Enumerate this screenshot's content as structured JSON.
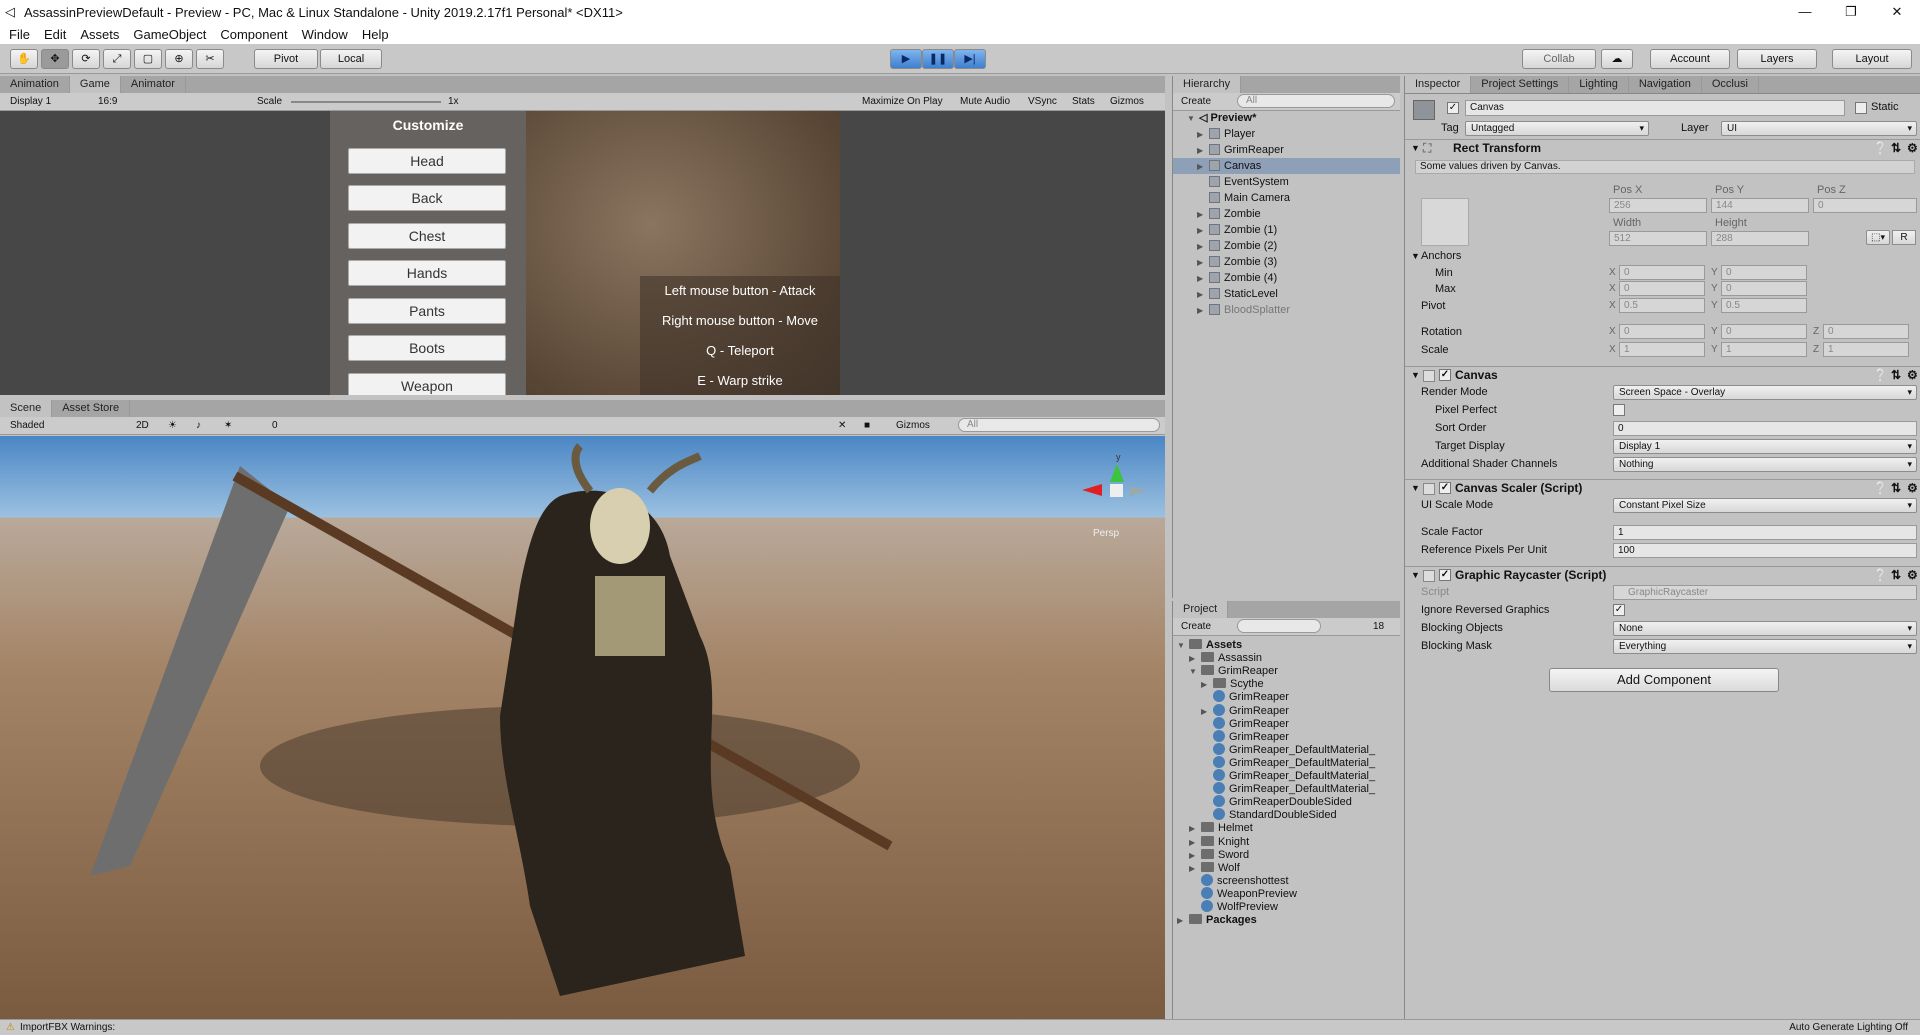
{
  "window": {
    "title": "AssassinPreviewDefault - Preview - PC, Mac & Linux Standalone - Unity 2019.2.17f1 Personal* <DX11>",
    "controls": [
      "—",
      "❐",
      "✕"
    ]
  },
  "menu": [
    "File",
    "Edit",
    "Assets",
    "GameObject",
    "Component",
    "Window",
    "Help"
  ],
  "toolbar": {
    "pivot": "Pivot",
    "local": "Local",
    "collab": "Collab",
    "account": "Account",
    "layers": "Layers",
    "layout": "Layout"
  },
  "game_tabs": [
    "Animation",
    "Game",
    "Animator"
  ],
  "game_bar": {
    "display": "Display 1",
    "aspect": "16:9",
    "scale_label": "Scale",
    "scale_value": "1x",
    "maximize": "Maximize On Play",
    "mute": "Mute Audio",
    "vsync": "VSync",
    "stats": "Stats",
    "gizmos": "Gizmos"
  },
  "customize": {
    "title": "Customize",
    "buttons": [
      "Head",
      "Back",
      "Chest",
      "Hands",
      "Pants",
      "Boots",
      "Weapon"
    ]
  },
  "controls_help": [
    "Left mouse button - Attack",
    "Right mouse button - Move",
    "Q - Teleport",
    "E - Warp strike"
  ],
  "scene_tabs": [
    "Scene",
    "Asset Store"
  ],
  "scene_bar": {
    "shading": "Shaded",
    "mode2d": "2D",
    "fx_count": "0",
    "gizmos": "Gizmos",
    "search": "All"
  },
  "scene_gizmo": {
    "y": "y",
    "persp": "Persp"
  },
  "hierarchy": {
    "tab": "Hierarchy",
    "create": "Create",
    "search": "All",
    "scene": "Preview*",
    "items": [
      {
        "name": "Player",
        "arrow": true,
        "dim": false
      },
      {
        "name": "GrimReaper",
        "arrow": true,
        "dim": false
      },
      {
        "name": "Canvas",
        "arrow": true,
        "dim": false,
        "selected": true
      },
      {
        "name": "EventSystem",
        "arrow": false,
        "dim": false
      },
      {
        "name": "Main Camera",
        "arrow": false,
        "dim": false
      },
      {
        "name": "Zombie",
        "arrow": true,
        "dim": false
      },
      {
        "name": "Zombie (1)",
        "arrow": true,
        "dim": false
      },
      {
        "name": "Zombie (2)",
        "arrow": true,
        "dim": false
      },
      {
        "name": "Zombie (3)",
        "arrow": true,
        "dim": false
      },
      {
        "name": "Zombie (4)",
        "arrow": true,
        "dim": false
      },
      {
        "name": "StaticLevel",
        "arrow": true,
        "dim": false
      },
      {
        "name": "BloodSplatter",
        "arrow": true,
        "dim": true
      }
    ]
  },
  "project": {
    "tab": "Project",
    "create": "Create",
    "count": "18",
    "items": [
      {
        "name": "Assets",
        "level": 0,
        "folder": true,
        "arrow": "open",
        "bold": true
      },
      {
        "name": "Assassin",
        "level": 1,
        "folder": true,
        "arrow": "closed"
      },
      {
        "name": "GrimReaper",
        "level": 1,
        "folder": true,
        "arrow": "open"
      },
      {
        "name": "Scythe",
        "level": 2,
        "folder": true,
        "arrow": "closed"
      },
      {
        "name": "GrimReaper",
        "level": 2,
        "folder": false,
        "arrow": "none"
      },
      {
        "name": "GrimReaper",
        "level": 2,
        "folder": false,
        "arrow": "closed"
      },
      {
        "name": "GrimReaper",
        "level": 2,
        "folder": false,
        "arrow": "none"
      },
      {
        "name": "GrimReaper",
        "level": 2,
        "folder": false,
        "arrow": "none"
      },
      {
        "name": "GrimReaper_DefaultMaterial_",
        "level": 2,
        "folder": false,
        "arrow": "none"
      },
      {
        "name": "GrimReaper_DefaultMaterial_",
        "level": 2,
        "folder": false,
        "arrow": "none"
      },
      {
        "name": "GrimReaper_DefaultMaterial_",
        "level": 2,
        "folder": false,
        "arrow": "none"
      },
      {
        "name": "GrimReaper_DefaultMaterial_",
        "level": 2,
        "folder": false,
        "arrow": "none"
      },
      {
        "name": "GrimReaperDoubleSided",
        "level": 2,
        "folder": false,
        "arrow": "none"
      },
      {
        "name": "StandardDoubleSided",
        "level": 2,
        "folder": false,
        "arrow": "none"
      },
      {
        "name": "Helmet",
        "level": 1,
        "folder": true,
        "arrow": "closed"
      },
      {
        "name": "Knight",
        "level": 1,
        "folder": true,
        "arrow": "closed"
      },
      {
        "name": "Sword",
        "level": 1,
        "folder": true,
        "arrow": "closed"
      },
      {
        "name": "Wolf",
        "level": 1,
        "folder": true,
        "arrow": "closed"
      },
      {
        "name": "screenshottest",
        "level": 1,
        "folder": false,
        "arrow": "none"
      },
      {
        "name": "WeaponPreview",
        "level": 1,
        "folder": false,
        "arrow": "none"
      },
      {
        "name": "WolfPreview",
        "level": 1,
        "folder": false,
        "arrow": "none"
      },
      {
        "name": "Packages",
        "level": 0,
        "folder": true,
        "arrow": "closed",
        "bold": true
      }
    ]
  },
  "inspector_tabs": [
    "Inspector",
    "Project Settings",
    "Lighting",
    "Navigation",
    "Occlusi"
  ],
  "inspector": {
    "object_name": "Canvas",
    "static": "Static",
    "tag_label": "Tag",
    "tag": "Untagged",
    "layer_label": "Layer",
    "layer": "UI",
    "rect": {
      "title": "Rect Transform",
      "note": "Some values driven by Canvas.",
      "posx_l": "Pos X",
      "posy_l": "Pos Y",
      "posz_l": "Pos Z",
      "posx": "256",
      "posy": "144",
      "posz": "0",
      "w_l": "Width",
      "h_l": "Height",
      "w": "512",
      "h": "288",
      "r": "R",
      "anchors": "Anchors",
      "min": "Min",
      "max": "Max",
      "pivot": "Pivot",
      "rotation": "Rotation",
      "scale": "Scale",
      "x": "X",
      "y": "Y",
      "z": "Z",
      "minx": "0",
      "miny": "0",
      "maxx": "0",
      "maxy": "0",
      "pivx": "0.5",
      "pivy": "0.5",
      "rotx": "0",
      "roty": "0",
      "rotz": "0",
      "sclx": "1",
      "scly": "1",
      "sclz": "1"
    },
    "canvas": {
      "title": "Canvas",
      "render_mode_l": "Render Mode",
      "render_mode": "Screen Space - Overlay",
      "pixel_perfect": "Pixel Perfect",
      "sort_order_l": "Sort Order",
      "sort_order": "0",
      "target_display_l": "Target Display",
      "target_display": "Display 1",
      "shader_l": "Additional Shader Channels",
      "shader": "Nothing"
    },
    "scaler": {
      "title": "Canvas Scaler (Script)",
      "mode_l": "UI Scale Mode",
      "mode": "Constant Pixel Size",
      "factor_l": "Scale Factor",
      "factor": "1",
      "ppu_l": "Reference Pixels Per Unit",
      "ppu": "100"
    },
    "raycaster": {
      "title": "Graphic Raycaster (Script)",
      "script_l": "Script",
      "script": "GraphicRaycaster",
      "ignore_l": "Ignore Reversed Graphics",
      "blocking_l": "Blocking Objects",
      "blocking": "None",
      "mask_l": "Blocking Mask",
      "mask": "Everything"
    },
    "add_component": "Add Component"
  },
  "status": {
    "left": "ImportFBX Warnings:",
    "right": "Auto Generate Lighting Off"
  }
}
